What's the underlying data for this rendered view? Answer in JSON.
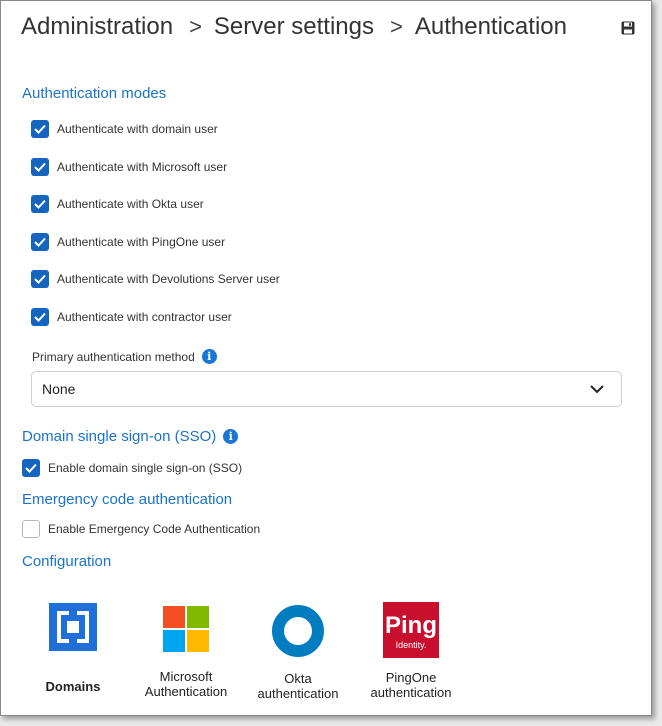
{
  "breadcrumb": [
    "Administration",
    "Server settings",
    "Authentication"
  ],
  "authentication_modes": {
    "title": "Authentication modes",
    "options": [
      {
        "label": "Authenticate with domain user",
        "checked": true
      },
      {
        "label": "Authenticate with Microsoft user",
        "checked": true
      },
      {
        "label": "Authenticate with Okta user",
        "checked": true
      },
      {
        "label": "Authenticate with PingOne user",
        "checked": true
      },
      {
        "label": "Authenticate with Devolutions Server user",
        "checked": true
      },
      {
        "label": "Authenticate with contractor user",
        "checked": true
      }
    ]
  },
  "primary_method": {
    "label": "Primary authentication method",
    "value": "None"
  },
  "sso": {
    "title": "Domain single sign-on (SSO)",
    "option": "Enable domain single sign-on (SSO)",
    "checked": true
  },
  "emergency": {
    "title": "Emergency code authentication",
    "option": "Enable Emergency Code Authentication",
    "checked": false
  },
  "configuration": {
    "title": "Configuration",
    "tiles": [
      {
        "label": "Domains",
        "icon": "domains-icon"
      },
      {
        "label": "Microsoft\nAuthentication",
        "icon": "microsoft-icon"
      },
      {
        "label": "Okta\nauthentication",
        "icon": "okta-icon"
      },
      {
        "label": "PingOne\nauthentication",
        "icon": "pingone-icon",
        "logo_text": "Ping",
        "logo_sub": "Identity."
      }
    ]
  },
  "colors": {
    "accent": "#1a73c8",
    "checkbox": "#1565c0",
    "ping": "#c8102e",
    "okta": "#007dc1"
  }
}
